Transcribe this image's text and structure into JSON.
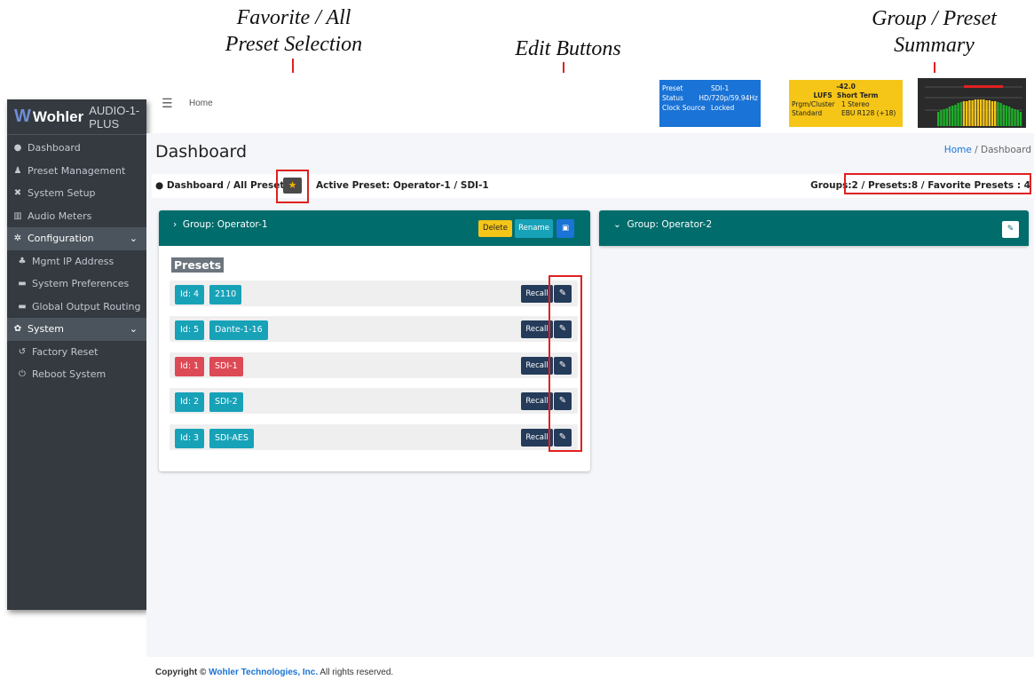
{
  "callouts": {
    "favorite": [
      "Favorite / All",
      "Preset Selection"
    ],
    "edit": "Edit Buttons",
    "summary": [
      "Group / Preset",
      "Summary"
    ]
  },
  "sidebar": {
    "brand_w": "W",
    "brand_name": "Wohler",
    "brand_model": "AUDIO-1-PLUS",
    "items": [
      {
        "label": "Dashboard",
        "icon": "tachometer-icon",
        "glyph": "●"
      },
      {
        "label": "Preset Management",
        "icon": "user-edit-icon",
        "glyph": "♟"
      },
      {
        "label": "System Setup",
        "icon": "tools-icon",
        "glyph": "✖"
      },
      {
        "label": "Audio Meters",
        "icon": "chart-icon",
        "glyph": "▥"
      },
      {
        "label": "Configuration",
        "icon": "gear-icon",
        "glyph": "✲"
      },
      {
        "label": "Mgmt IP Address",
        "icon": "network-icon",
        "glyph": "♣"
      },
      {
        "label": "System Preferences",
        "icon": "keyboard-icon",
        "glyph": "▬"
      },
      {
        "label": "Global Output Routing",
        "icon": "keyboard-icon",
        "glyph": "▬"
      },
      {
        "label": "System",
        "icon": "cogs-icon",
        "glyph": "✿"
      },
      {
        "label": "Factory Reset",
        "icon": "undo-icon",
        "glyph": "↺"
      },
      {
        "label": "Reboot System",
        "icon": "power-icon",
        "glyph": "⏻"
      }
    ]
  },
  "header": {
    "home": "Home",
    "info": {
      "preset_k": "Preset",
      "preset_v": "SDI-1",
      "status_k": "Status",
      "status_v": "HD/720p/59.94Hz",
      "clock_k": "Clock Source",
      "clock_v": "Locked"
    },
    "lufs": {
      "value": "-42.0",
      "lufs_label": "LUFS",
      "term": "Short Term",
      "prgm_k": "Prgm/Cluster",
      "prgm_v": "1  Stereo",
      "std_k": "Standard",
      "std_v": "EBU R128 (+18)"
    }
  },
  "page": {
    "title": "Dashboard",
    "crumb_home": "Home",
    "crumb_sep": " / ",
    "crumb_current": "Dashboard",
    "toolbar_left": "Dashboard / All Presets",
    "active_preset": "Active Preset: Operator-1 / SDI-1",
    "summary": "Groups:2 / Presets:8 / Favorite Presets : 4"
  },
  "groups": [
    {
      "title": "Group: Operator-1",
      "delete": "Delete",
      "rename": "Rename",
      "presets_label": "Presets",
      "presets": [
        {
          "id": "Id: 4",
          "name": "2110",
          "recall": "Recall",
          "active": false
        },
        {
          "id": "Id: 5",
          "name": "Dante-1-16",
          "recall": "Recall",
          "active": false
        },
        {
          "id": "Id: 1",
          "name": "SDI-1",
          "recall": "Recall",
          "active": true
        },
        {
          "id": "Id: 2",
          "name": "SDI-2",
          "recall": "Recall",
          "active": false
        },
        {
          "id": "Id: 3",
          "name": "SDI-AES",
          "recall": "Recall",
          "active": false
        }
      ]
    },
    {
      "title": "Group: Operator-2"
    }
  ],
  "footer": {
    "prefix": "Copyright ©",
    "company": "Wohler Technologies, Inc.",
    "suffix": "All rights reserved."
  }
}
